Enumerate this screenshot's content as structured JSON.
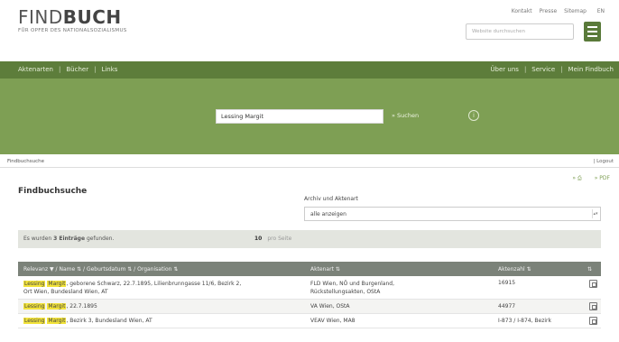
{
  "header": {
    "logo_title_thin": "FIND",
    "logo_title_bold": "BUCH",
    "logo_subtitle": "FÜR OPFER DES NATIONALSOZIALISMUS",
    "toplinks": [
      "Kontakt",
      "Presse",
      "Sitemap"
    ],
    "language": "EN",
    "site_search_placeholder": "Website durchsuchen"
  },
  "nav": {
    "left": [
      "Aktenarten",
      "Bücher",
      "Links"
    ],
    "right": [
      "Über uns",
      "Service",
      "Mein Findbuch"
    ],
    "separator": "|"
  },
  "search": {
    "value": "Lessing Margit",
    "button_label": "» Suchen",
    "info_icon": "i"
  },
  "breadcrumb": {
    "text": "Findbuchsuche",
    "logout": "| Logout"
  },
  "export": {
    "print_label": "» ⎙",
    "pdf_label": "» PDF"
  },
  "page_title": "Findbuchsuche",
  "filter": {
    "label": "Archiv und Aktenart",
    "selected": "alle anzeigen"
  },
  "results": {
    "prefix": "Es wurden ",
    "count_label": "3 Einträge",
    "suffix": " gefunden.",
    "per_page_value": "10",
    "per_page_label": "pro Seite"
  },
  "table": {
    "headers": {
      "col1": "Relevanz ▼ / Name ⇅ / Geburtsdatum ⇅ / Organisation ⇅",
      "col2": "Aktenart ⇅",
      "col3": "Aktenzahl ⇅",
      "col4": "⇅"
    },
    "rows": [
      {
        "name_hl1": "Lessing",
        "name_hl2": "Margit",
        "details": ", geborene Schwarz, 22.7.1895, Lilienbrunngasse 11/6, Bezirk 2,",
        "details2": "Ort Wien, Bundesland Wien, AT",
        "aktenart": "FLD Wien, NÖ und Burgenland,",
        "aktenart2": "Rückstellungsakten, OStA",
        "aktenzahl": "16915"
      },
      {
        "name_hl1": "Lessing",
        "name_hl2": "Margit",
        "details": ", 22.7.1895",
        "details2": "",
        "aktenart": "VA Wien, OStA",
        "aktenart2": "",
        "aktenzahl": "44977"
      },
      {
        "name_hl1": "Lessing",
        "name_hl2": "Margit",
        "details": ", Bezirk 3, Bundesland Wien, AT",
        "details2": "",
        "aktenart": "VEAV Wien, MA8",
        "aktenart2": "",
        "aktenzahl": "I-873 / I-874, Bezirk"
      }
    ]
  },
  "colors": {
    "nav_green": "#5d7d3b",
    "band_green": "#7e9f54",
    "highlight": "#f2e33a",
    "table_header": "#7b8279"
  }
}
